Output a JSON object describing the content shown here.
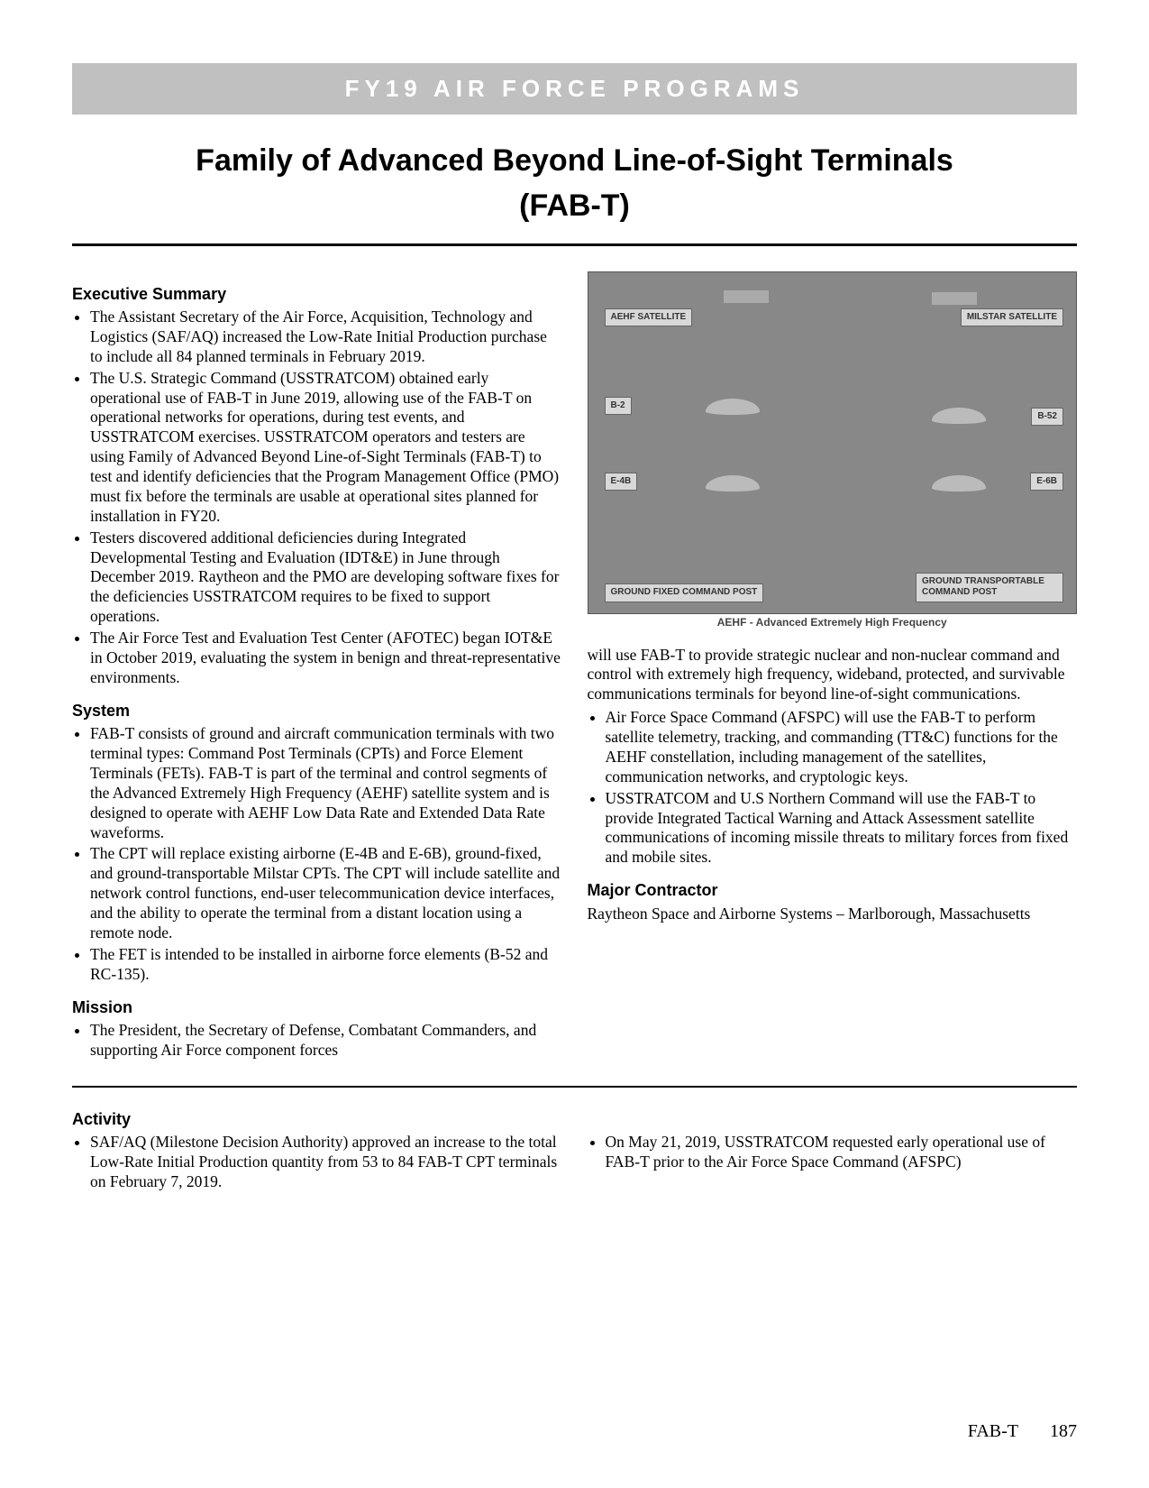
{
  "banner": "FY19 AIR FORCE PROGRAMS",
  "title": "Family of Advanced Beyond Line-of-Sight Terminals",
  "subtitle": "(FAB-T)",
  "sections": {
    "executive_summary": {
      "heading": "Executive Summary",
      "items": [
        "The Assistant Secretary of the Air Force, Acquisition, Technology and Logistics (SAF/AQ) increased the Low-Rate Initial Production purchase to include all 84 planned terminals in February 2019.",
        "The U.S. Strategic Command (USSTRATCOM) obtained early operational use of FAB-T in June 2019, allowing use of the FAB-T on operational networks for operations, during test events, and USSTRATCOM exercises. USSTRATCOM operators and testers are using Family of Advanced Beyond Line-of-Sight Terminals (FAB-T) to test and identify deficiencies that the Program Management Office (PMO) must fix before the terminals are usable at operational sites planned for installation in FY20.",
        "Testers discovered additional deficiencies during Integrated Developmental Testing and Evaluation (IDT&E) in June through December 2019. Raytheon and the PMO are developing software fixes for the deficiencies USSTRATCOM requires to be fixed to support operations.",
        "The Air Force Test and Evaluation Test Center (AFOTEC) began IOT&E in October 2019, evaluating the system in benign and threat-representative environments."
      ]
    },
    "system": {
      "heading": "System",
      "items": [
        "FAB-T consists of ground and aircraft communication terminals with two terminal types: Command Post Terminals (CPTs) and Force Element Terminals (FETs). FAB-T is part of the terminal and control segments of the Advanced Extremely High Frequency (AEHF) satellite system and is designed to operate with AEHF Low Data Rate and Extended Data Rate waveforms.",
        "The CPT will replace existing airborne (E-4B and E-6B), ground-fixed, and ground-transportable Milstar CPTs. The CPT will include satellite and network control functions, end-user telecommunication device interfaces, and the ability to operate the terminal from a distant location using a remote node.",
        "The FET is intended to be installed in airborne force elements (B-52 and RC-135)."
      ]
    },
    "mission": {
      "heading": "Mission",
      "left_items": [
        "The President, the Secretary of Defense, Combatant Commanders, and supporting Air Force component forces"
      ],
      "right_continuation": "will use FAB-T to provide strategic nuclear and non-nuclear command and control with extremely high frequency, wideband, protected, and survivable communications terminals for beyond line-of-sight communications.",
      "right_items": [
        "Air Force Space Command (AFSPC) will use the FAB-T to perform satellite telemetry, tracking, and commanding (TT&C) functions for the AEHF constellation, including management of the satellites, communication networks, and cryptologic keys.",
        "USSTRATCOM and U.S Northern Command will use the FAB-T to provide Integrated Tactical Warning and Attack Assessment satellite communications of incoming missile threats to military forces from fixed and mobile sites."
      ]
    },
    "major_contractor": {
      "heading": "Major Contractor",
      "text": "Raytheon Space and Airborne Systems – Marlborough, Massachusetts"
    },
    "activity": {
      "heading": "Activity",
      "left_items": [
        "SAF/AQ (Milestone Decision Authority) approved an increase to the total Low-Rate Initial Production quantity from 53 to 84 FAB-T CPT terminals on February 7, 2019."
      ],
      "right_items": [
        "On May 21, 2019, USSTRATCOM requested early operational use of FAB-T prior to the Air Force Space Command (AFSPC)"
      ]
    }
  },
  "figure": {
    "labels": {
      "aehf_sat": "AEHF SATELLITE",
      "milstar_sat": "MILSTAR SATELLITE",
      "b2": "B-2",
      "b52": "B-52",
      "e4b": "E-4B",
      "e6b": "E-6B",
      "ground_fixed": "GROUND FIXED COMMAND POST",
      "ground_trans": "GROUND TRANSPORTABLE COMMAND POST"
    },
    "caption": "AEHF - Advanced Extremely High Frequency"
  },
  "footer": {
    "label": "FAB-T",
    "page": "187"
  }
}
